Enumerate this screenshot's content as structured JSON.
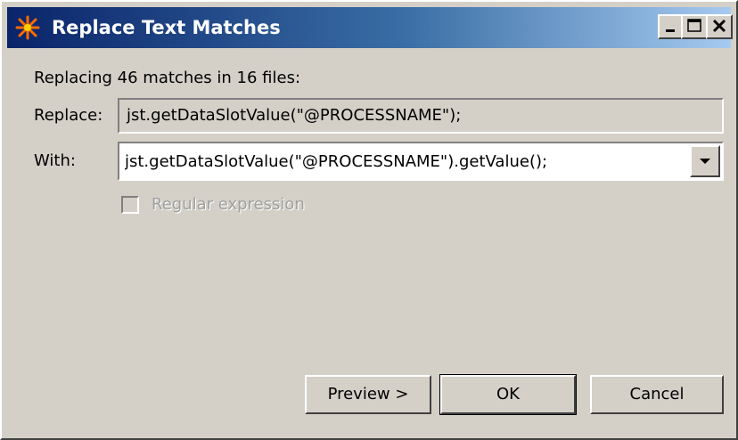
{
  "window": {
    "title": "Replace Text Matches"
  },
  "summary": {
    "text": "Replacing 46 matches in 16 files:"
  },
  "replace": {
    "label": "Replace:",
    "value": "jst.getDataSlotValue(\"@PROCESSNAME\");"
  },
  "with": {
    "label": "With:",
    "value": "jst.getDataSlotValue(\"@PROCESSNAME\").getValue();"
  },
  "regex": {
    "label": "Regular expression",
    "checked": false,
    "enabled": false
  },
  "buttons": {
    "preview": "Preview >",
    "ok": "OK",
    "cancel": "Cancel"
  },
  "icons": {
    "app": "eclipse-star-icon",
    "minimize": "minimize-icon",
    "maximize": "maximize-icon",
    "close": "close-icon",
    "dropdown": "chevron-down-icon"
  },
  "colors": {
    "title_start": "#0a246a",
    "title_end": "#a6caf0",
    "dialog_bg": "#d4d0c8",
    "app_icon": "#ff6a00"
  }
}
